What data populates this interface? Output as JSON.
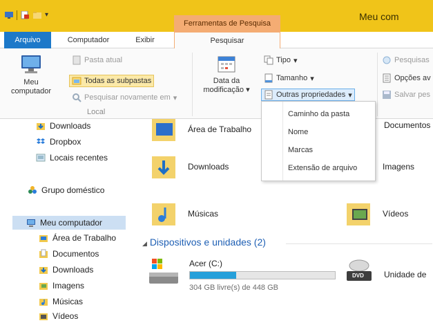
{
  "window": {
    "title": "Meu com",
    "contextual_tab_group": "Ferramentas de Pesquisa"
  },
  "ribbon_tabs": {
    "file": "Arquivo",
    "computer": "Computador",
    "view": "Exibir",
    "search": "Pesquisar"
  },
  "ribbon": {
    "local_group": {
      "my_computer": [
        "Meu",
        "computador"
      ],
      "current_folder": "Pasta atual",
      "all_subfolders": "Todas as subpastas",
      "search_again": "Pesquisar novamente em",
      "label": "Local"
    },
    "refine_group": {
      "date_modified": [
        "Data da",
        "modificação"
      ],
      "kind": "Tipo",
      "size": "Tamanho",
      "other_properties": "Outras propriedades"
    },
    "options_group": {
      "recent_searches": "Pesquisas",
      "advanced_options": "Opções av",
      "save_search": "Salvar pes"
    }
  },
  "dropdown": {
    "items": [
      "Caminho da pasta",
      "Nome",
      "Marcas",
      "Extensão de arquivo"
    ]
  },
  "nav_pane": {
    "favorites": [
      "Downloads",
      "Dropbox",
      "Locais recentes"
    ],
    "homegroup": "Grupo doméstico",
    "this_pc": "Meu computador",
    "this_pc_children": [
      "Área de Trabalho",
      "Documentos",
      "Downloads",
      "Imagens",
      "Músicas",
      "Vídeos"
    ]
  },
  "content": {
    "folders_left": [
      "Área de Trabalho",
      "Downloads",
      "Músicas"
    ],
    "folders_right": [
      "Documentos",
      "Imagens",
      "Vídeos"
    ],
    "devices_header": "Dispositivos e unidades (2)",
    "drive_c": {
      "name": "Acer (C:)",
      "free_text": "304 GB livre(s) de 448 GB",
      "used_fraction": 0.32
    },
    "dvd_drive": {
      "name": "Unidade de",
      "badge": "DVD"
    }
  },
  "colors": {
    "titlebar": "#f0c419",
    "file_tab": "#1d79c9",
    "search_tools": "#f4ac73",
    "section_header": "#1e5fb4",
    "drive_fill": "#26a0da"
  }
}
